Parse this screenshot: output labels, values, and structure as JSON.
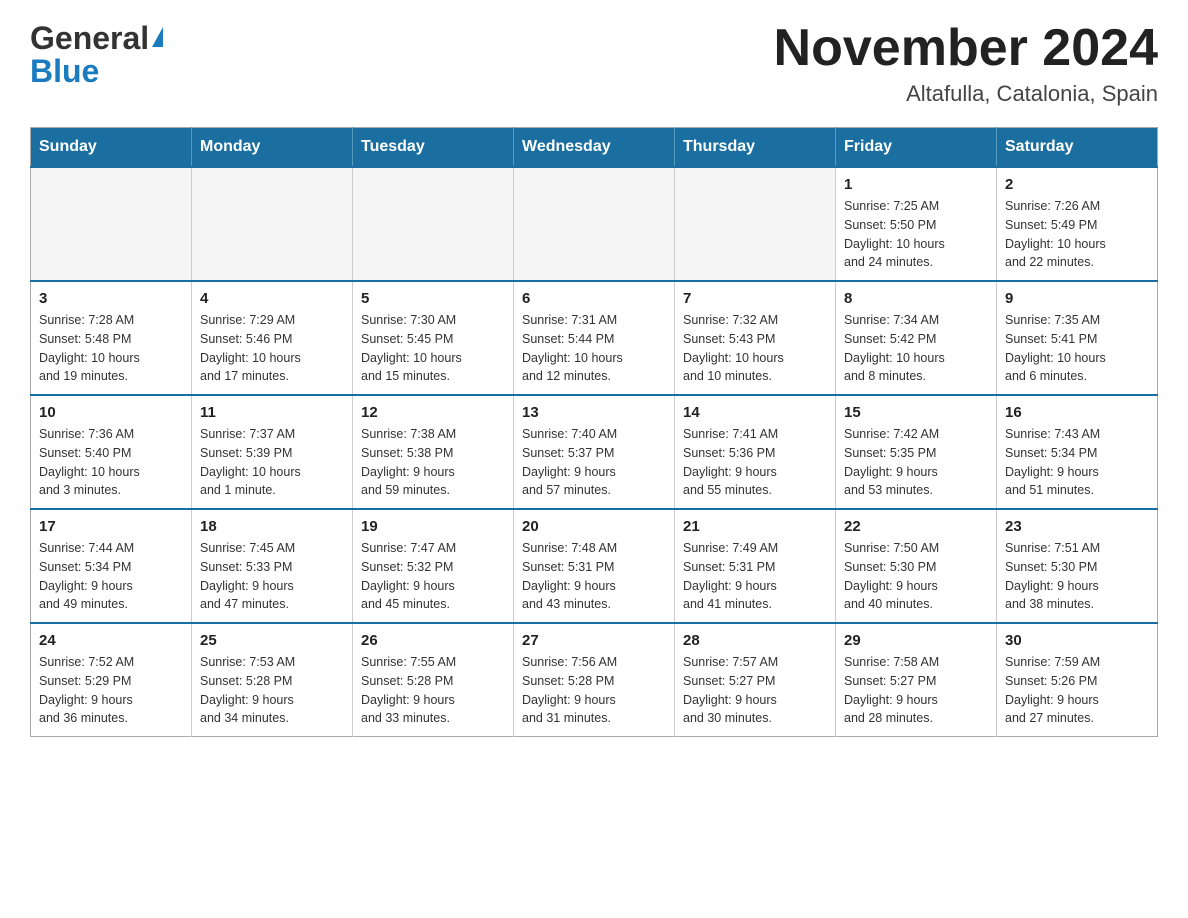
{
  "header": {
    "logo_general": "General",
    "logo_blue": "Blue",
    "month_title": "November 2024",
    "location": "Altafulla, Catalonia, Spain"
  },
  "weekdays": [
    "Sunday",
    "Monday",
    "Tuesday",
    "Wednesday",
    "Thursday",
    "Friday",
    "Saturday"
  ],
  "weeks": [
    [
      {
        "day": "",
        "info": ""
      },
      {
        "day": "",
        "info": ""
      },
      {
        "day": "",
        "info": ""
      },
      {
        "day": "",
        "info": ""
      },
      {
        "day": "",
        "info": ""
      },
      {
        "day": "1",
        "info": "Sunrise: 7:25 AM\nSunset: 5:50 PM\nDaylight: 10 hours\nand 24 minutes."
      },
      {
        "day": "2",
        "info": "Sunrise: 7:26 AM\nSunset: 5:49 PM\nDaylight: 10 hours\nand 22 minutes."
      }
    ],
    [
      {
        "day": "3",
        "info": "Sunrise: 7:28 AM\nSunset: 5:48 PM\nDaylight: 10 hours\nand 19 minutes."
      },
      {
        "day": "4",
        "info": "Sunrise: 7:29 AM\nSunset: 5:46 PM\nDaylight: 10 hours\nand 17 minutes."
      },
      {
        "day": "5",
        "info": "Sunrise: 7:30 AM\nSunset: 5:45 PM\nDaylight: 10 hours\nand 15 minutes."
      },
      {
        "day": "6",
        "info": "Sunrise: 7:31 AM\nSunset: 5:44 PM\nDaylight: 10 hours\nand 12 minutes."
      },
      {
        "day": "7",
        "info": "Sunrise: 7:32 AM\nSunset: 5:43 PM\nDaylight: 10 hours\nand 10 minutes."
      },
      {
        "day": "8",
        "info": "Sunrise: 7:34 AM\nSunset: 5:42 PM\nDaylight: 10 hours\nand 8 minutes."
      },
      {
        "day": "9",
        "info": "Sunrise: 7:35 AM\nSunset: 5:41 PM\nDaylight: 10 hours\nand 6 minutes."
      }
    ],
    [
      {
        "day": "10",
        "info": "Sunrise: 7:36 AM\nSunset: 5:40 PM\nDaylight: 10 hours\nand 3 minutes."
      },
      {
        "day": "11",
        "info": "Sunrise: 7:37 AM\nSunset: 5:39 PM\nDaylight: 10 hours\nand 1 minute."
      },
      {
        "day": "12",
        "info": "Sunrise: 7:38 AM\nSunset: 5:38 PM\nDaylight: 9 hours\nand 59 minutes."
      },
      {
        "day": "13",
        "info": "Sunrise: 7:40 AM\nSunset: 5:37 PM\nDaylight: 9 hours\nand 57 minutes."
      },
      {
        "day": "14",
        "info": "Sunrise: 7:41 AM\nSunset: 5:36 PM\nDaylight: 9 hours\nand 55 minutes."
      },
      {
        "day": "15",
        "info": "Sunrise: 7:42 AM\nSunset: 5:35 PM\nDaylight: 9 hours\nand 53 minutes."
      },
      {
        "day": "16",
        "info": "Sunrise: 7:43 AM\nSunset: 5:34 PM\nDaylight: 9 hours\nand 51 minutes."
      }
    ],
    [
      {
        "day": "17",
        "info": "Sunrise: 7:44 AM\nSunset: 5:34 PM\nDaylight: 9 hours\nand 49 minutes."
      },
      {
        "day": "18",
        "info": "Sunrise: 7:45 AM\nSunset: 5:33 PM\nDaylight: 9 hours\nand 47 minutes."
      },
      {
        "day": "19",
        "info": "Sunrise: 7:47 AM\nSunset: 5:32 PM\nDaylight: 9 hours\nand 45 minutes."
      },
      {
        "day": "20",
        "info": "Sunrise: 7:48 AM\nSunset: 5:31 PM\nDaylight: 9 hours\nand 43 minutes."
      },
      {
        "day": "21",
        "info": "Sunrise: 7:49 AM\nSunset: 5:31 PM\nDaylight: 9 hours\nand 41 minutes."
      },
      {
        "day": "22",
        "info": "Sunrise: 7:50 AM\nSunset: 5:30 PM\nDaylight: 9 hours\nand 40 minutes."
      },
      {
        "day": "23",
        "info": "Sunrise: 7:51 AM\nSunset: 5:30 PM\nDaylight: 9 hours\nand 38 minutes."
      }
    ],
    [
      {
        "day": "24",
        "info": "Sunrise: 7:52 AM\nSunset: 5:29 PM\nDaylight: 9 hours\nand 36 minutes."
      },
      {
        "day": "25",
        "info": "Sunrise: 7:53 AM\nSunset: 5:28 PM\nDaylight: 9 hours\nand 34 minutes."
      },
      {
        "day": "26",
        "info": "Sunrise: 7:55 AM\nSunset: 5:28 PM\nDaylight: 9 hours\nand 33 minutes."
      },
      {
        "day": "27",
        "info": "Sunrise: 7:56 AM\nSunset: 5:28 PM\nDaylight: 9 hours\nand 31 minutes."
      },
      {
        "day": "28",
        "info": "Sunrise: 7:57 AM\nSunset: 5:27 PM\nDaylight: 9 hours\nand 30 minutes."
      },
      {
        "day": "29",
        "info": "Sunrise: 7:58 AM\nSunset: 5:27 PM\nDaylight: 9 hours\nand 28 minutes."
      },
      {
        "day": "30",
        "info": "Sunrise: 7:59 AM\nSunset: 5:26 PM\nDaylight: 9 hours\nand 27 minutes."
      }
    ]
  ]
}
